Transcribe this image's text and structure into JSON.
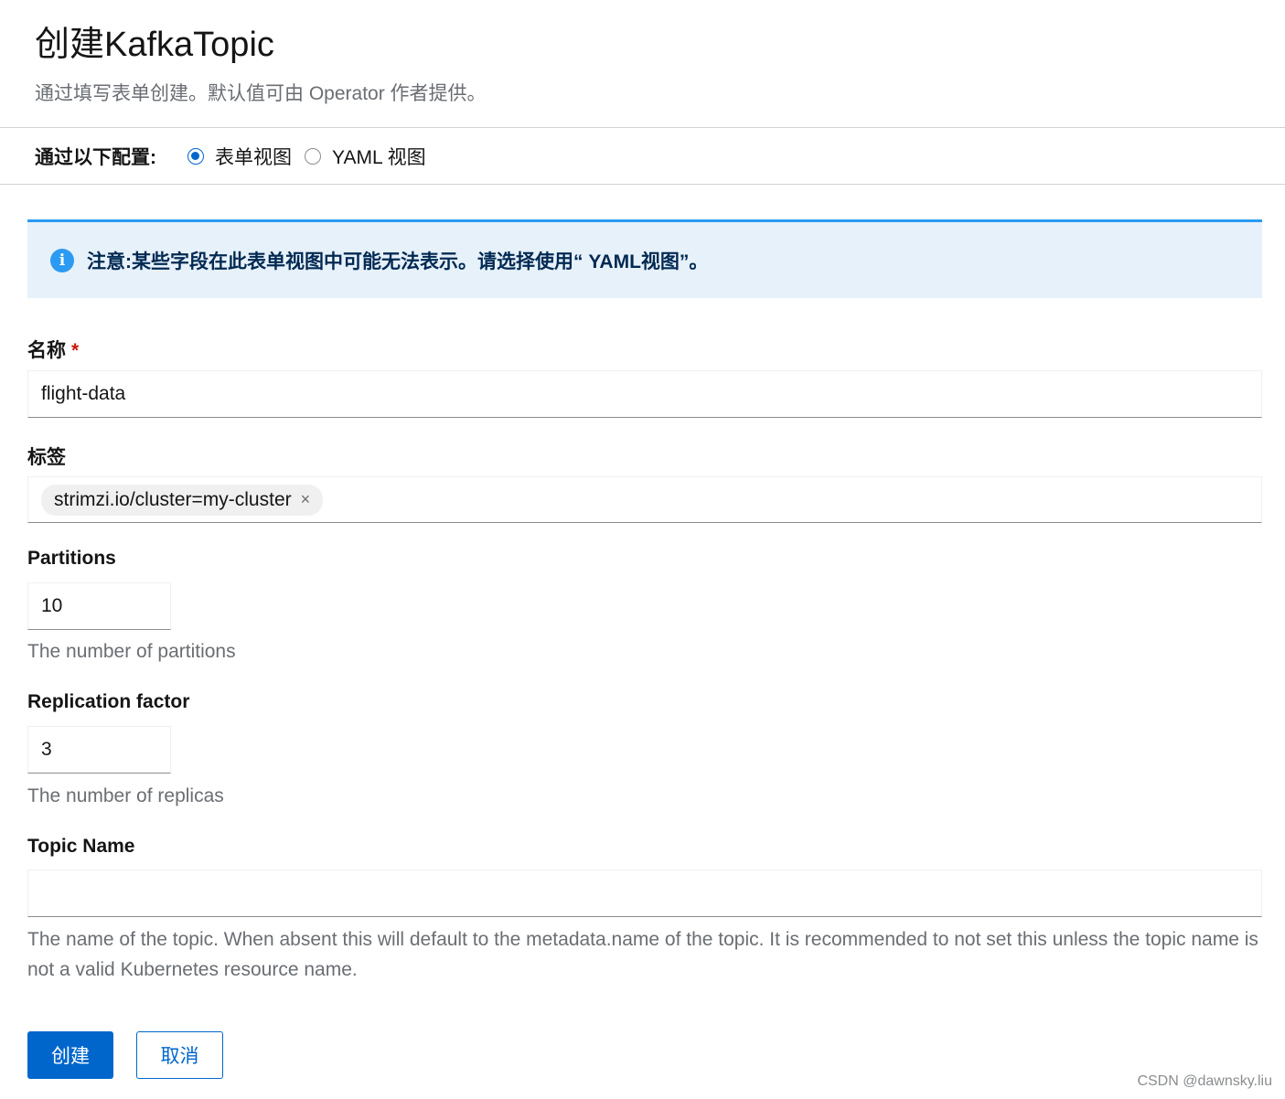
{
  "header": {
    "title": "创建KafkaTopic",
    "subtitle": "通过填写表单创建。默认值可由 Operator 作者提供。"
  },
  "config": {
    "label": "通过以下配置:",
    "options": [
      {
        "label": "表单视图",
        "selected": true
      },
      {
        "label": "YAML 视图",
        "selected": false
      }
    ]
  },
  "alert": {
    "icon": "info-icon",
    "text": "注意:某些字段在此表单视图中可能无法表示。请选择使用“ YAML视图”。"
  },
  "fields": {
    "name": {
      "label": "名称",
      "required_mark": "*",
      "value": "flight-data"
    },
    "labels": {
      "label": "标签",
      "chips": [
        "strimzi.io/cluster=my-cluster"
      ],
      "chip_close": "×"
    },
    "partitions": {
      "label": "Partitions",
      "value": "10",
      "helper": "The number of partitions"
    },
    "replication": {
      "label": "Replication factor",
      "value": "3",
      "helper": "The number of replicas"
    },
    "topic_name": {
      "label": "Topic Name",
      "value": "",
      "helper": "The name of the topic. When absent this will default to the metadata.name of the topic. It is recommended to not set this unless the topic name is not a valid Kubernetes resource name."
    }
  },
  "actions": {
    "create": "创建",
    "cancel": "取消"
  },
  "watermark": "CSDN @dawnsky.liu",
  "colors": {
    "primary": "#0066cc",
    "alert_bg": "#e7f1fa",
    "alert_border": "#2b9af3",
    "required": "#c9190b"
  }
}
